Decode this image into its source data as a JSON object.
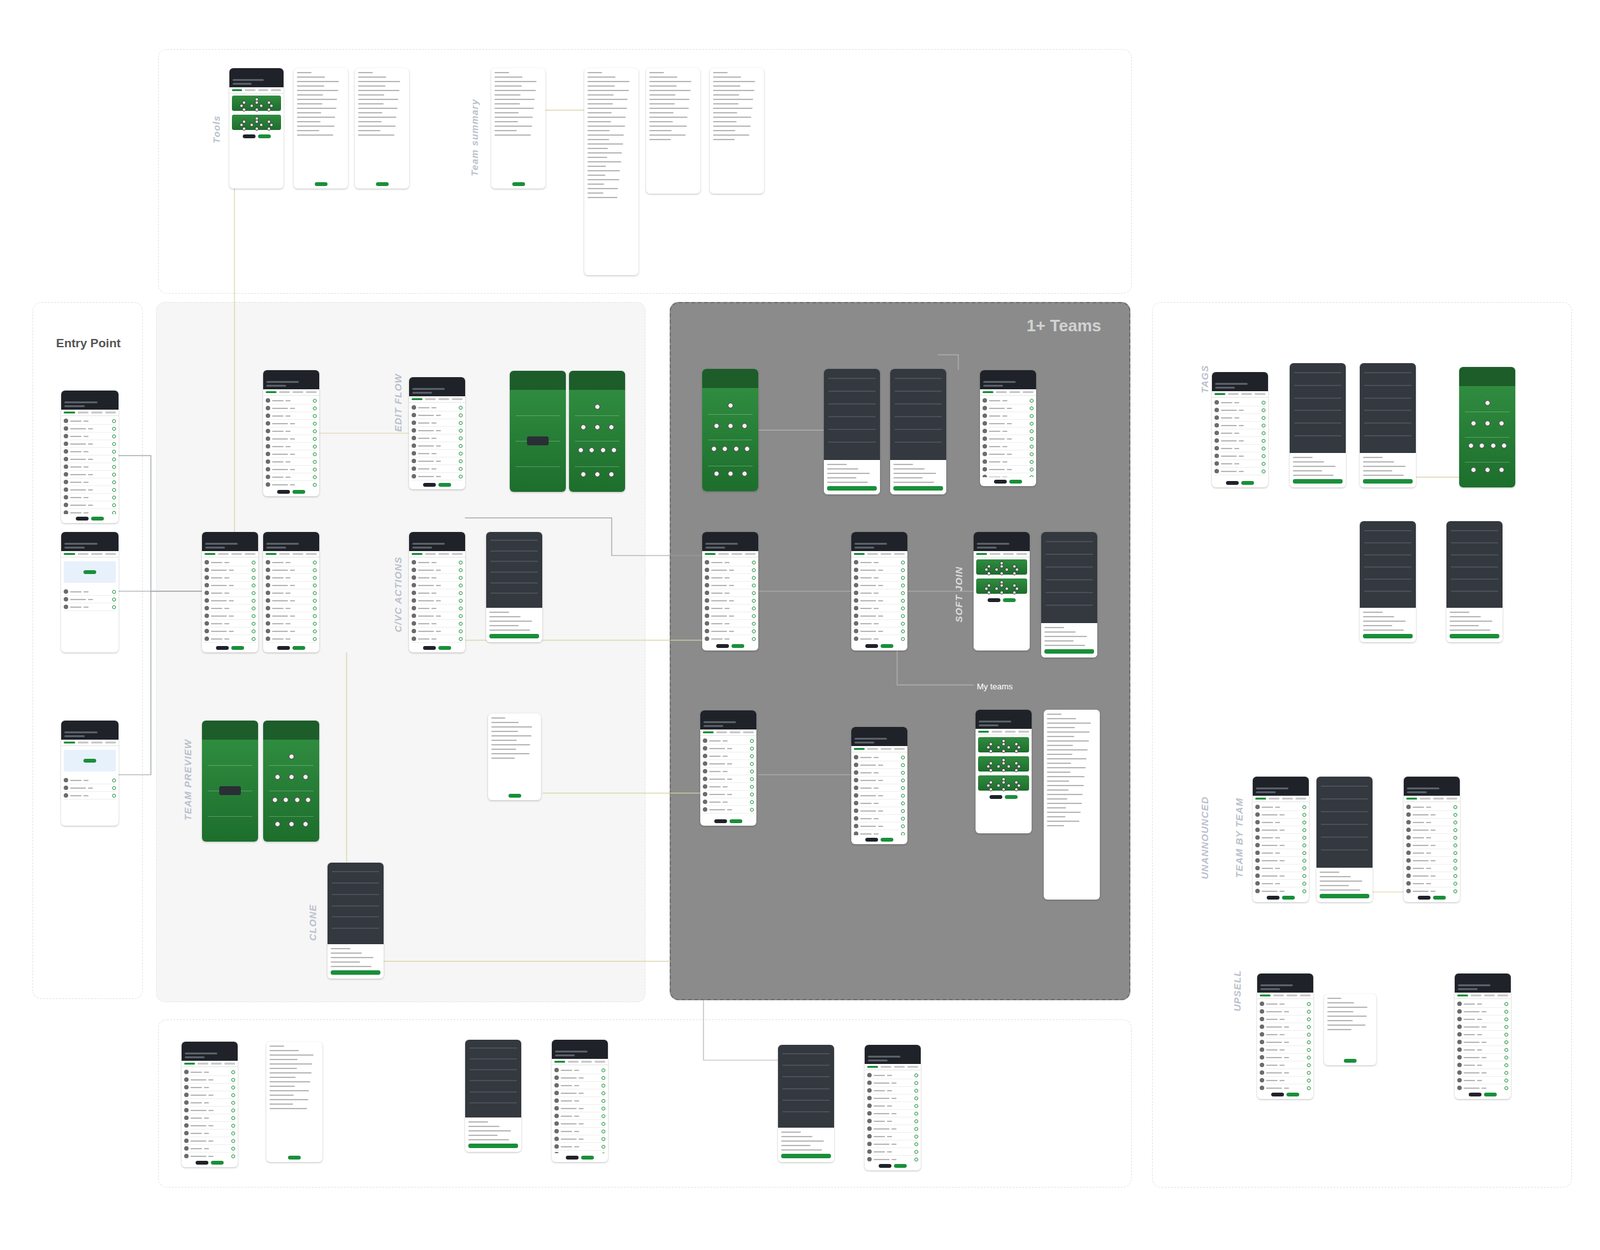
{
  "panels": [
    {
      "title": ""
    },
    {
      "title": "Entry Point"
    },
    {
      "title": ""
    },
    {
      "title": "1+ Teams"
    },
    {
      "title": ""
    },
    {
      "title": ""
    }
  ],
  "labels": [
    {
      "text": "Tools"
    },
    {
      "text": "Team summary"
    },
    {
      "text": "EDIT FLOW"
    },
    {
      "text": "C/VC ACTIONS"
    },
    {
      "text": "TEAM PREVIEW"
    },
    {
      "text": "CLONE"
    },
    {
      "text": "SOFT JOIN"
    },
    {
      "text": "TAGS"
    },
    {
      "text": "UNANNOUNCED"
    },
    {
      "text": "TEAM BY TEAM"
    },
    {
      "text": "UPSELL"
    }
  ],
  "notes": [
    {
      "text": "My teams"
    }
  ],
  "screens": [
    {
      "kind": "cards"
    },
    {
      "kind": "form"
    },
    {
      "kind": "form"
    },
    {
      "kind": "form"
    },
    {
      "kind": "summary"
    },
    {
      "kind": "summary"
    },
    {
      "kind": "summary"
    },
    {
      "kind": "list"
    },
    {
      "kind": "empty"
    },
    {
      "kind": "empty"
    },
    {
      "kind": "list"
    },
    {
      "kind": "list"
    },
    {
      "kind": "list"
    },
    {
      "kind": "list"
    },
    {
      "kind": "pitch-empty"
    },
    {
      "kind": "pitch"
    },
    {
      "kind": "list"
    },
    {
      "kind": "modal"
    },
    {
      "kind": "pitch-empty"
    },
    {
      "kind": "pitch"
    },
    {
      "kind": "modal"
    },
    {
      "kind": "form"
    },
    {
      "kind": "pitch"
    },
    {
      "kind": "modal"
    },
    {
      "kind": "modal"
    },
    {
      "kind": "list"
    },
    {
      "kind": "list"
    },
    {
      "kind": "list"
    },
    {
      "kind": "cards"
    },
    {
      "kind": "modal"
    },
    {
      "kind": "list"
    },
    {
      "kind": "list"
    },
    {
      "kind": "cards"
    },
    {
      "kind": "summary"
    },
    {
      "kind": "list"
    },
    {
      "kind": "modal"
    },
    {
      "kind": "modal"
    },
    {
      "kind": "pitch"
    },
    {
      "kind": "modal"
    },
    {
      "kind": "modal"
    },
    {
      "kind": "list"
    },
    {
      "kind": "modal"
    },
    {
      "kind": "list"
    },
    {
      "kind": "list"
    },
    {
      "kind": "form"
    },
    {
      "kind": "list"
    },
    {
      "kind": "list"
    },
    {
      "kind": "form"
    },
    {
      "kind": "modal"
    },
    {
      "kind": "list"
    },
    {
      "kind": "modal"
    },
    {
      "kind": "list"
    }
  ]
}
